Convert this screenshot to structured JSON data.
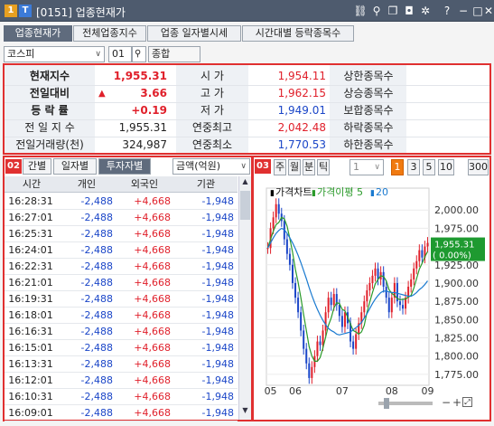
{
  "window": {
    "title": "[0151] 업종현재가",
    "badge1": "1",
    "badge2": "T"
  },
  "tabs": [
    "업종현재가",
    "전체업종지수",
    "업종 일자별시세",
    "시간대별 등락종목수"
  ],
  "search": {
    "market": "코스피",
    "code": "01",
    "name": "종합"
  },
  "summary": {
    "badge": "01",
    "left": [
      {
        "label": "현재지수",
        "value": "1,955.31",
        "arrow": ""
      },
      {
        "label": "전일대비",
        "value": "3.66",
        "arrow": "▲"
      },
      {
        "label": "등 락 률",
        "value": "+0.19",
        "arrow": ""
      },
      {
        "label": "전 일 지 수",
        "value": "1,955.31",
        "arrow": ""
      },
      {
        "label": "전일거래량(천)",
        "value": "324,987",
        "arrow": ""
      }
    ],
    "right": [
      {
        "label": "시 가",
        "value": "1,954.11",
        "color": "red"
      },
      {
        "label": "고 가",
        "value": "1,962.15",
        "color": "red"
      },
      {
        "label": "저 가",
        "value": "1,949.01",
        "color": "blue"
      },
      {
        "label": "연중최고",
        "value": "2,042.48",
        "color": "red"
      },
      {
        "label": "연중최소",
        "value": "1,770.53",
        "color": "blue"
      }
    ],
    "counts": [
      "상한종목수",
      "상승종목수",
      "보합종목수",
      "하락종목수",
      "하한종목수"
    ]
  },
  "investor": {
    "badge": "02",
    "tabs": [
      "간별",
      "일자별",
      "투자자별"
    ],
    "unit": "금액(억원)",
    "columns": [
      "시간",
      "개인",
      "외국인",
      "기관"
    ],
    "rows": [
      [
        "16:28:31",
        "-2,488",
        "+4,668",
        "-1,948"
      ],
      [
        "16:27:01",
        "-2,488",
        "+4,668",
        "-1,948"
      ],
      [
        "16:25:31",
        "-2,488",
        "+4,668",
        "-1,948"
      ],
      [
        "16:24:01",
        "-2,488",
        "+4,668",
        "-1,948"
      ],
      [
        "16:22:31",
        "-2,488",
        "+4,668",
        "-1,948"
      ],
      [
        "16:21:01",
        "-2,488",
        "+4,668",
        "-1,948"
      ],
      [
        "16:19:31",
        "-2,488",
        "+4,668",
        "-1,948"
      ],
      [
        "16:18:01",
        "-2,488",
        "+4,668",
        "-1,948"
      ],
      [
        "16:16:31",
        "-2,488",
        "+4,668",
        "-1,948"
      ],
      [
        "16:15:01",
        "-2,488",
        "+4,668",
        "-1,948"
      ],
      [
        "16:13:31",
        "-2,488",
        "+4,668",
        "-1,948"
      ],
      [
        "16:12:01",
        "-2,488",
        "+4,668",
        "-1,948"
      ],
      [
        "16:10:31",
        "-2,488",
        "+4,668",
        "-1,948"
      ],
      [
        "16:09:01",
        "-2,488",
        "+4,668",
        "-1,948"
      ]
    ]
  },
  "chartpanel": {
    "badge": "03",
    "periods": [
      "주",
      "월",
      "분",
      "틱"
    ],
    "combo": "1",
    "nums": [
      "1",
      "3",
      "5",
      "10"
    ],
    "active_num": "1",
    "count": "300",
    "legend": [
      "가격차트",
      "가격이평 5",
      "20"
    ],
    "current_price": "1,955.31",
    "current_change": "( 0.00%)"
  },
  "chart_data": {
    "type": "line",
    "title": "가격차트",
    "ylim": [
      1760,
      2030
    ],
    "yticks": [
      1775,
      1800,
      1825,
      1850,
      1875,
      1900,
      1925,
      1950,
      1975,
      2000
    ],
    "ytick_labels": [
      "1,775.00",
      "1,800.00",
      "1,825.00",
      "1,850.00",
      "1,875.00",
      "1,900.00",
      "1,925.00",
      "1,950.00",
      "1,975.00",
      "2,000.00"
    ],
    "xtick_labels": [
      "05",
      "06",
      "07",
      "08",
      "09"
    ],
    "xtick_index": [
      1,
      10,
      27,
      45,
      58
    ],
    "close": [
      1948,
      1975,
      1990,
      2008,
      1995,
      1985,
      1960,
      1940,
      1925,
      1900,
      1880,
      1860,
      1835,
      1810,
      1790,
      1770,
      1785,
      1800,
      1820,
      1815,
      1835,
      1860,
      1880,
      1870,
      1885,
      1870,
      1855,
      1840,
      1860,
      1845,
      1820,
      1810,
      1830,
      1845,
      1860,
      1875,
      1890,
      1900,
      1910,
      1920,
      1905,
      1915,
      1895,
      1880,
      1860,
      1880,
      1900,
      1875,
      1870,
      1865,
      1880,
      1895,
      1905,
      1920,
      1930,
      1945,
      1935,
      1950,
      1955
    ],
    "series": [
      {
        "name": "가격이평 5",
        "values": [
          1948,
          1960,
          1971,
          1980,
          1983,
          1990,
          1988,
          1978,
          1961,
          1942,
          1919,
          1901,
          1880,
          1857,
          1835,
          1813,
          1800,
          1793,
          1793,
          1798,
          1811,
          1826,
          1842,
          1852,
          1866,
          1873,
          1872,
          1864,
          1862,
          1853,
          1844,
          1835,
          1833,
          1830,
          1833,
          1842,
          1860,
          1874,
          1887,
          1899,
          1905,
          1910,
          1909,
          1903,
          1891,
          1886,
          1883,
          1879,
          1877,
          1878,
          1878,
          1881,
          1883,
          1893,
          1906,
          1919,
          1927,
          1936,
          1943
        ]
      },
      {
        "name": "20",
        "values": [
          1948,
          1955,
          1962,
          1968,
          1972,
          1975,
          1973,
          1968,
          1962,
          1955,
          1947,
          1938,
          1928,
          1917,
          1906,
          1894,
          1883,
          1873,
          1864,
          1856,
          1849,
          1843,
          1838,
          1835,
          1833,
          1830,
          1829,
          1830,
          1831,
          1832,
          1833,
          1836,
          1839,
          1842,
          1846,
          1852,
          1858,
          1865,
          1872,
          1878,
          1883,
          1887,
          1889,
          1889,
          1888,
          1887,
          1887,
          1886,
          1885,
          1884,
          1883,
          1882,
          1882,
          1884,
          1887,
          1891,
          1894,
          1898,
          1903
        ]
      }
    ]
  }
}
